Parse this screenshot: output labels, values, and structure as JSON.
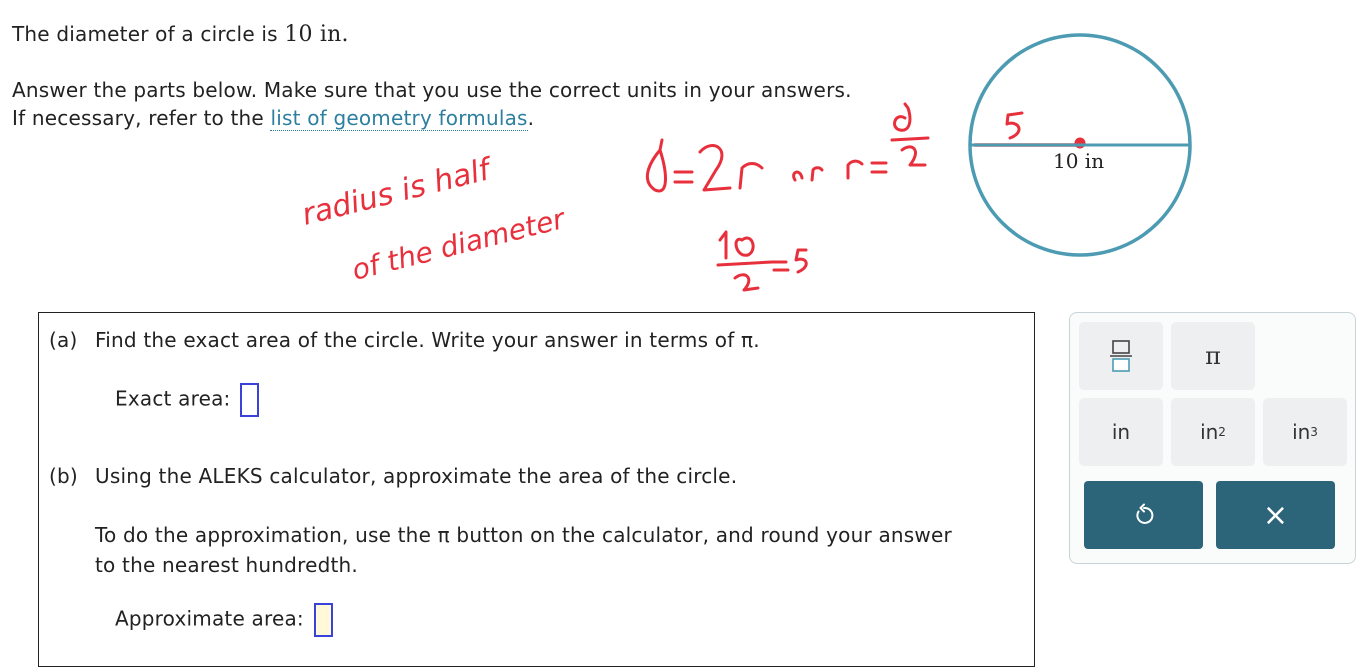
{
  "prompt": {
    "text_before": "The diameter of a circle is ",
    "value": "10 in."
  },
  "instructions": {
    "line1": "Answer the parts below. Make sure that you use the correct units in your answers.",
    "line2_before": "If necessary, refer to the ",
    "link": "list of geometry formulas",
    "line2_after": "."
  },
  "handwriting": {
    "note1": "radius is half",
    "note2": "of the diameter",
    "formula": "d = 2r  or  r = d/2",
    "calc": "10/2 = 5",
    "radius_mark": "5"
  },
  "figure": {
    "label": "10 in"
  },
  "question": {
    "part_a_label": "(a)",
    "part_a_text": "Find the exact area of the circle. Write your answer in terms of π.",
    "exact_label": "Exact area:",
    "part_b_label": "(b)",
    "part_b_text": "Using the ALEKS calculator, approximate the area of the circle.",
    "part_b_line1": "To do the approximation, use the π button on the calculator, and round your answer",
    "part_b_line2": "to the nearest hundredth.",
    "approx_label": "Approximate area:"
  },
  "keypad": {
    "pi": "π",
    "in": "in",
    "in2_base": "in",
    "in2_exp": "2",
    "in3_base": "in",
    "in3_exp": "3",
    "clear": "×"
  },
  "colors": {
    "circle": "#4c9bb3",
    "ink": "#e8303d",
    "accent": "#2c6479",
    "answer_border": "#3b42d8"
  }
}
